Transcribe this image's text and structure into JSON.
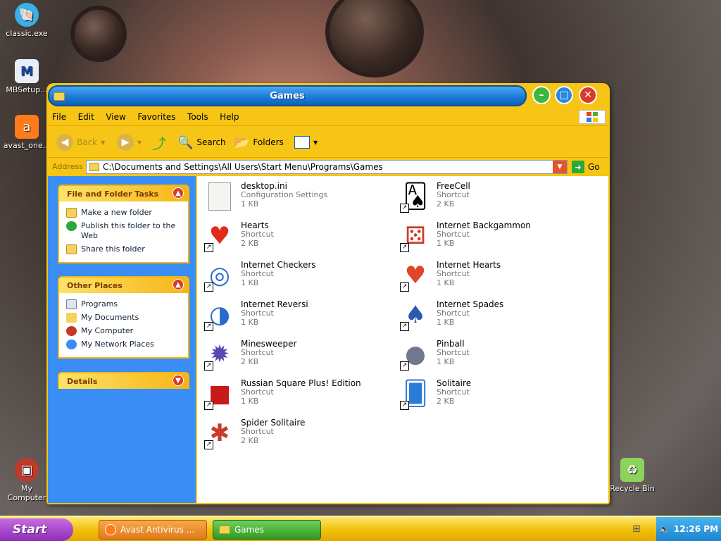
{
  "desktop": {
    "icons": [
      {
        "label": "classic.exe"
      },
      {
        "label": "MBSetup..."
      },
      {
        "label": "avast_one..."
      },
      {
        "label": "My Computer"
      },
      {
        "label": "Recycle Bin"
      }
    ]
  },
  "window": {
    "title": "Games",
    "controls": {
      "minimize": "–",
      "maximize": "□",
      "close": "✕"
    }
  },
  "menu": [
    "File",
    "Edit",
    "View",
    "Favorites",
    "Tools",
    "Help"
  ],
  "toolbar": {
    "back": "Back",
    "search": "Search",
    "folders": "Folders"
  },
  "address": {
    "label": "Address",
    "value": "C:\\Documents and Settings\\All Users\\Start Menu\\Programs\\Games",
    "go": "Go"
  },
  "sidebar": {
    "file_tasks": {
      "title": "File and Folder Tasks",
      "items": [
        "Make a new folder",
        "Publish this folder to the Web",
        "Share this folder"
      ]
    },
    "other_places": {
      "title": "Other Places",
      "items": [
        "Programs",
        "My Documents",
        "My Computer",
        "My Network Places"
      ]
    },
    "details": {
      "title": "Details"
    }
  },
  "files": [
    {
      "name": "desktop.ini",
      "type": "Configuration Settings",
      "size": "1 KB"
    },
    {
      "name": "FreeCell",
      "type": "Shortcut",
      "size": "2 KB"
    },
    {
      "name": "Hearts",
      "type": "Shortcut",
      "size": "2 KB"
    },
    {
      "name": "Internet Backgammon",
      "type": "Shortcut",
      "size": "1 KB"
    },
    {
      "name": "Internet Checkers",
      "type": "Shortcut",
      "size": "1 KB"
    },
    {
      "name": "Internet Hearts",
      "type": "Shortcut",
      "size": "1 KB"
    },
    {
      "name": "Internet Reversi",
      "type": "Shortcut",
      "size": "1 KB"
    },
    {
      "name": "Internet Spades",
      "type": "Shortcut",
      "size": "1 KB"
    },
    {
      "name": "Minesweeper",
      "type": "Shortcut",
      "size": "2 KB"
    },
    {
      "name": "Pinball",
      "type": "Shortcut",
      "size": "1 KB"
    },
    {
      "name": "Russian Square Plus! Edition",
      "type": "Shortcut",
      "size": "1 KB"
    },
    {
      "name": "Solitaire",
      "type": "Shortcut",
      "size": "2 KB"
    },
    {
      "name": "Spider Solitaire",
      "type": "Shortcut",
      "size": "2 KB"
    }
  ],
  "taskbar": {
    "start": "Start",
    "tasks": [
      "Avast Antivirus ...",
      "Games"
    ],
    "clock": "12:26 PM"
  },
  "colors": {
    "window_frame": "#f7c516",
    "title_blue": "#1a78d6",
    "sidebar_blue": "#3a8df5",
    "start_purple": "#8b2db7"
  }
}
